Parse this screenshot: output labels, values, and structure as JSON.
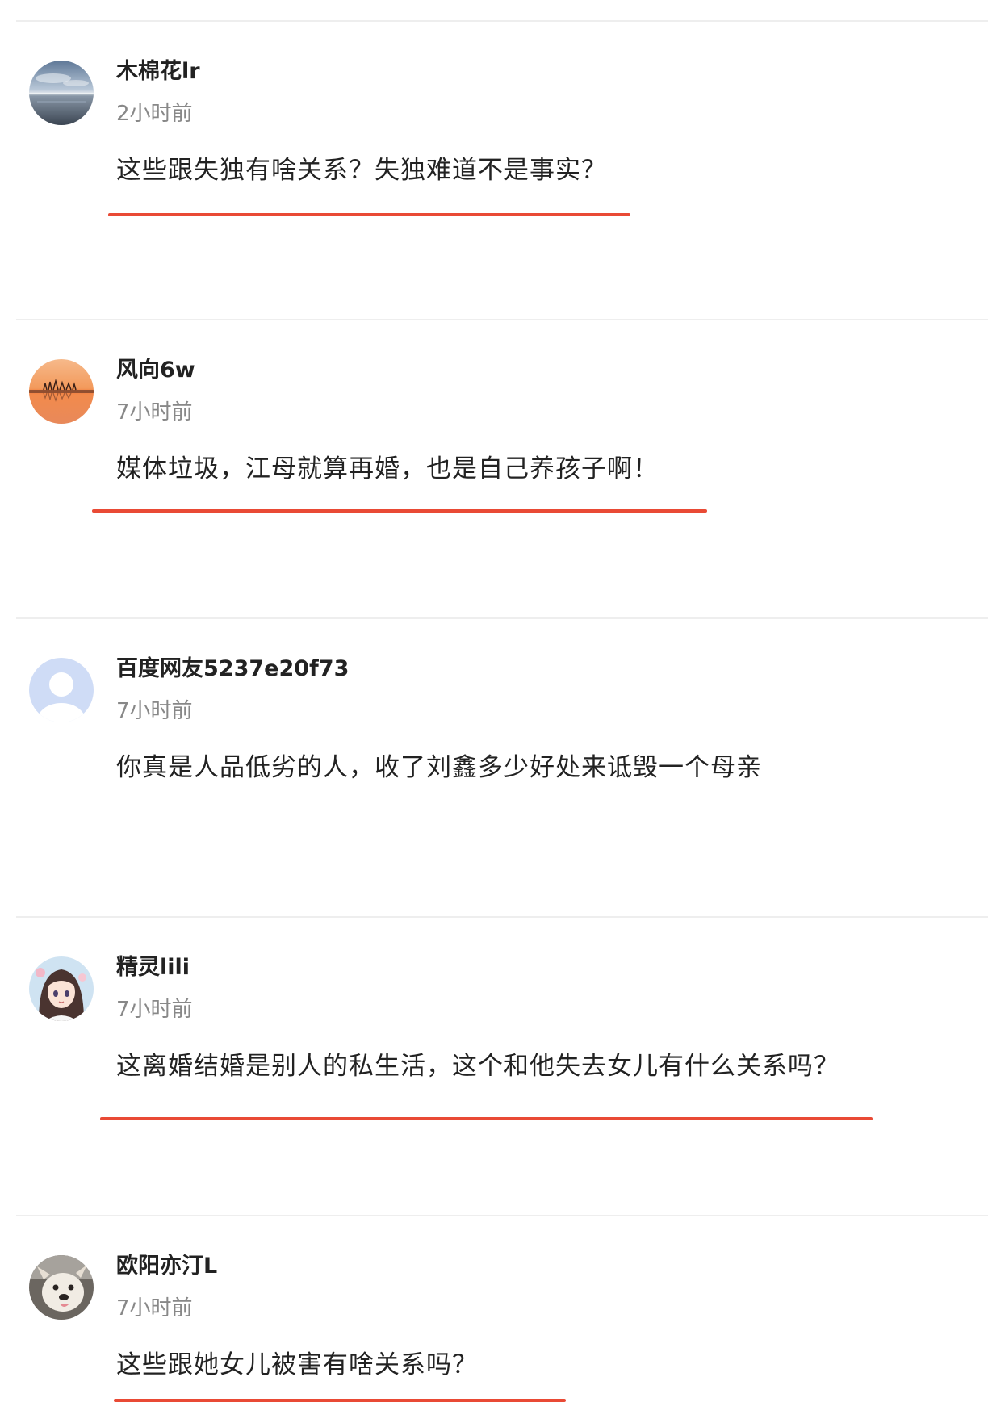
{
  "accent_color": "#e94a35",
  "comments": [
    {
      "username": "木棉花lr",
      "time": "2小时前",
      "text": "这些跟失独有啥关系？失独难道不是事实？",
      "avatar_icon": "sea-horizon-avatar-icon",
      "underlined": true
    },
    {
      "username": "风向6w",
      "time": "7小时前",
      "text": "媒体垃圾，江母就算再婚，也是自己养孩子啊！",
      "avatar_icon": "sunset-avatar-icon",
      "underlined": true
    },
    {
      "username": "百度网友5237e20f73",
      "time": "7小时前",
      "text": "你真是人品低劣的人，收了刘鑫多少好处来诋毁一个母亲",
      "avatar_icon": "default-user-avatar-icon",
      "underlined": false
    },
    {
      "username": "精灵lili",
      "time": "7小时前",
      "text": "这离婚结婚是别人的私生活，这个和他失去女儿有什么关系吗？",
      "avatar_icon": "anime-girl-avatar-icon",
      "underlined": true
    },
    {
      "username": "欧阳亦汀L",
      "time": "7小时前",
      "text": "这些跟她女儿被害有啥关系吗？",
      "avatar_icon": "dog-avatar-icon",
      "underlined": true
    }
  ]
}
